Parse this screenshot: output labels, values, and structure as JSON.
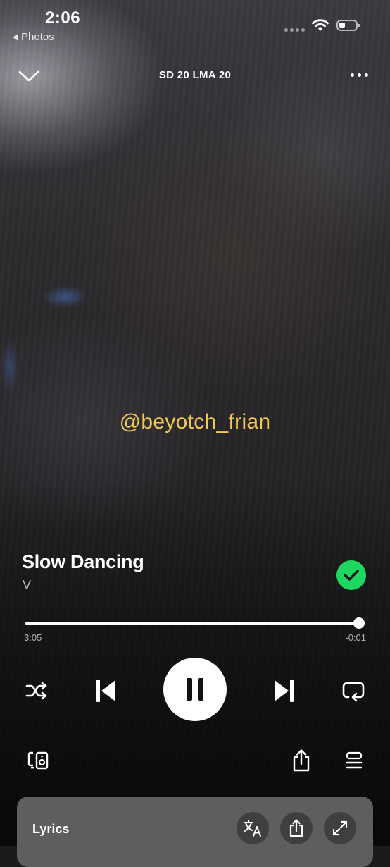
{
  "status_bar": {
    "time": "2:06",
    "back_app": "Photos",
    "battery_level": 0.35
  },
  "header": {
    "context_title": "SD 20 LMA 20"
  },
  "watermark": "@beyotch_frian",
  "track": {
    "title": "Slow Dancing",
    "artist": "V",
    "liked": true
  },
  "progress": {
    "elapsed": "3:05",
    "remaining": "-0:01",
    "fraction": 0.995
  },
  "controls": {
    "playing": true
  },
  "lyrics": {
    "label": "Lyrics"
  },
  "colors": {
    "accent_green": "#1ed760",
    "watermark_yellow": "#f2c94c"
  },
  "icons": [
    "chevron-down-icon",
    "more-options-icon",
    "check-icon",
    "shuffle-icon",
    "previous-icon",
    "pause-icon",
    "next-icon",
    "repeat-icon",
    "connect-device-icon",
    "share-icon",
    "queue-icon",
    "translate-icon",
    "expand-icon",
    "wifi-icon",
    "battery-icon"
  ]
}
